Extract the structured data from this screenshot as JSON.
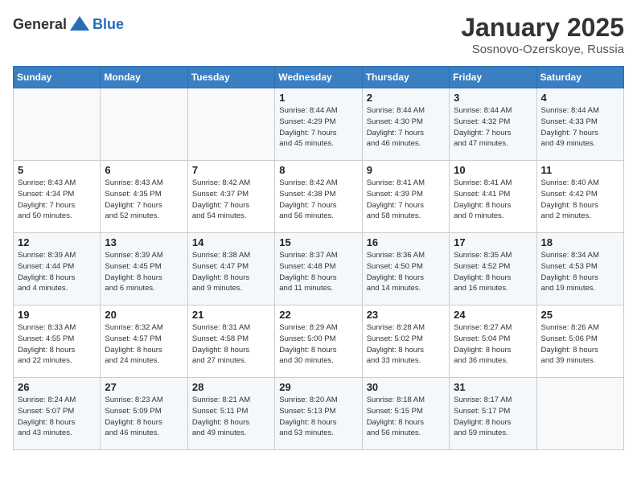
{
  "header": {
    "logo_general": "General",
    "logo_blue": "Blue",
    "month": "January 2025",
    "location": "Sosnovo-Ozerskoye, Russia"
  },
  "days_of_week": [
    "Sunday",
    "Monday",
    "Tuesday",
    "Wednesday",
    "Thursday",
    "Friday",
    "Saturday"
  ],
  "weeks": [
    [
      {
        "day": "",
        "info": ""
      },
      {
        "day": "",
        "info": ""
      },
      {
        "day": "",
        "info": ""
      },
      {
        "day": "1",
        "info": "Sunrise: 8:44 AM\nSunset: 4:29 PM\nDaylight: 7 hours\nand 45 minutes."
      },
      {
        "day": "2",
        "info": "Sunrise: 8:44 AM\nSunset: 4:30 PM\nDaylight: 7 hours\nand 46 minutes."
      },
      {
        "day": "3",
        "info": "Sunrise: 8:44 AM\nSunset: 4:32 PM\nDaylight: 7 hours\nand 47 minutes."
      },
      {
        "day": "4",
        "info": "Sunrise: 8:44 AM\nSunset: 4:33 PM\nDaylight: 7 hours\nand 49 minutes."
      }
    ],
    [
      {
        "day": "5",
        "info": "Sunrise: 8:43 AM\nSunset: 4:34 PM\nDaylight: 7 hours\nand 50 minutes."
      },
      {
        "day": "6",
        "info": "Sunrise: 8:43 AM\nSunset: 4:35 PM\nDaylight: 7 hours\nand 52 minutes."
      },
      {
        "day": "7",
        "info": "Sunrise: 8:42 AM\nSunset: 4:37 PM\nDaylight: 7 hours\nand 54 minutes."
      },
      {
        "day": "8",
        "info": "Sunrise: 8:42 AM\nSunset: 4:38 PM\nDaylight: 7 hours\nand 56 minutes."
      },
      {
        "day": "9",
        "info": "Sunrise: 8:41 AM\nSunset: 4:39 PM\nDaylight: 7 hours\nand 58 minutes."
      },
      {
        "day": "10",
        "info": "Sunrise: 8:41 AM\nSunset: 4:41 PM\nDaylight: 8 hours\nand 0 minutes."
      },
      {
        "day": "11",
        "info": "Sunrise: 8:40 AM\nSunset: 4:42 PM\nDaylight: 8 hours\nand 2 minutes."
      }
    ],
    [
      {
        "day": "12",
        "info": "Sunrise: 8:39 AM\nSunset: 4:44 PM\nDaylight: 8 hours\nand 4 minutes."
      },
      {
        "day": "13",
        "info": "Sunrise: 8:39 AM\nSunset: 4:45 PM\nDaylight: 8 hours\nand 6 minutes."
      },
      {
        "day": "14",
        "info": "Sunrise: 8:38 AM\nSunset: 4:47 PM\nDaylight: 8 hours\nand 9 minutes."
      },
      {
        "day": "15",
        "info": "Sunrise: 8:37 AM\nSunset: 4:48 PM\nDaylight: 8 hours\nand 11 minutes."
      },
      {
        "day": "16",
        "info": "Sunrise: 8:36 AM\nSunset: 4:50 PM\nDaylight: 8 hours\nand 14 minutes."
      },
      {
        "day": "17",
        "info": "Sunrise: 8:35 AM\nSunset: 4:52 PM\nDaylight: 8 hours\nand 16 minutes."
      },
      {
        "day": "18",
        "info": "Sunrise: 8:34 AM\nSunset: 4:53 PM\nDaylight: 8 hours\nand 19 minutes."
      }
    ],
    [
      {
        "day": "19",
        "info": "Sunrise: 8:33 AM\nSunset: 4:55 PM\nDaylight: 8 hours\nand 22 minutes."
      },
      {
        "day": "20",
        "info": "Sunrise: 8:32 AM\nSunset: 4:57 PM\nDaylight: 8 hours\nand 24 minutes."
      },
      {
        "day": "21",
        "info": "Sunrise: 8:31 AM\nSunset: 4:58 PM\nDaylight: 8 hours\nand 27 minutes."
      },
      {
        "day": "22",
        "info": "Sunrise: 8:29 AM\nSunset: 5:00 PM\nDaylight: 8 hours\nand 30 minutes."
      },
      {
        "day": "23",
        "info": "Sunrise: 8:28 AM\nSunset: 5:02 PM\nDaylight: 8 hours\nand 33 minutes."
      },
      {
        "day": "24",
        "info": "Sunrise: 8:27 AM\nSunset: 5:04 PM\nDaylight: 8 hours\nand 36 minutes."
      },
      {
        "day": "25",
        "info": "Sunrise: 8:26 AM\nSunset: 5:06 PM\nDaylight: 8 hours\nand 39 minutes."
      }
    ],
    [
      {
        "day": "26",
        "info": "Sunrise: 8:24 AM\nSunset: 5:07 PM\nDaylight: 8 hours\nand 43 minutes."
      },
      {
        "day": "27",
        "info": "Sunrise: 8:23 AM\nSunset: 5:09 PM\nDaylight: 8 hours\nand 46 minutes."
      },
      {
        "day": "28",
        "info": "Sunrise: 8:21 AM\nSunset: 5:11 PM\nDaylight: 8 hours\nand 49 minutes."
      },
      {
        "day": "29",
        "info": "Sunrise: 8:20 AM\nSunset: 5:13 PM\nDaylight: 8 hours\nand 53 minutes."
      },
      {
        "day": "30",
        "info": "Sunrise: 8:18 AM\nSunset: 5:15 PM\nDaylight: 8 hours\nand 56 minutes."
      },
      {
        "day": "31",
        "info": "Sunrise: 8:17 AM\nSunset: 5:17 PM\nDaylight: 8 hours\nand 59 minutes."
      },
      {
        "day": "",
        "info": ""
      }
    ]
  ]
}
